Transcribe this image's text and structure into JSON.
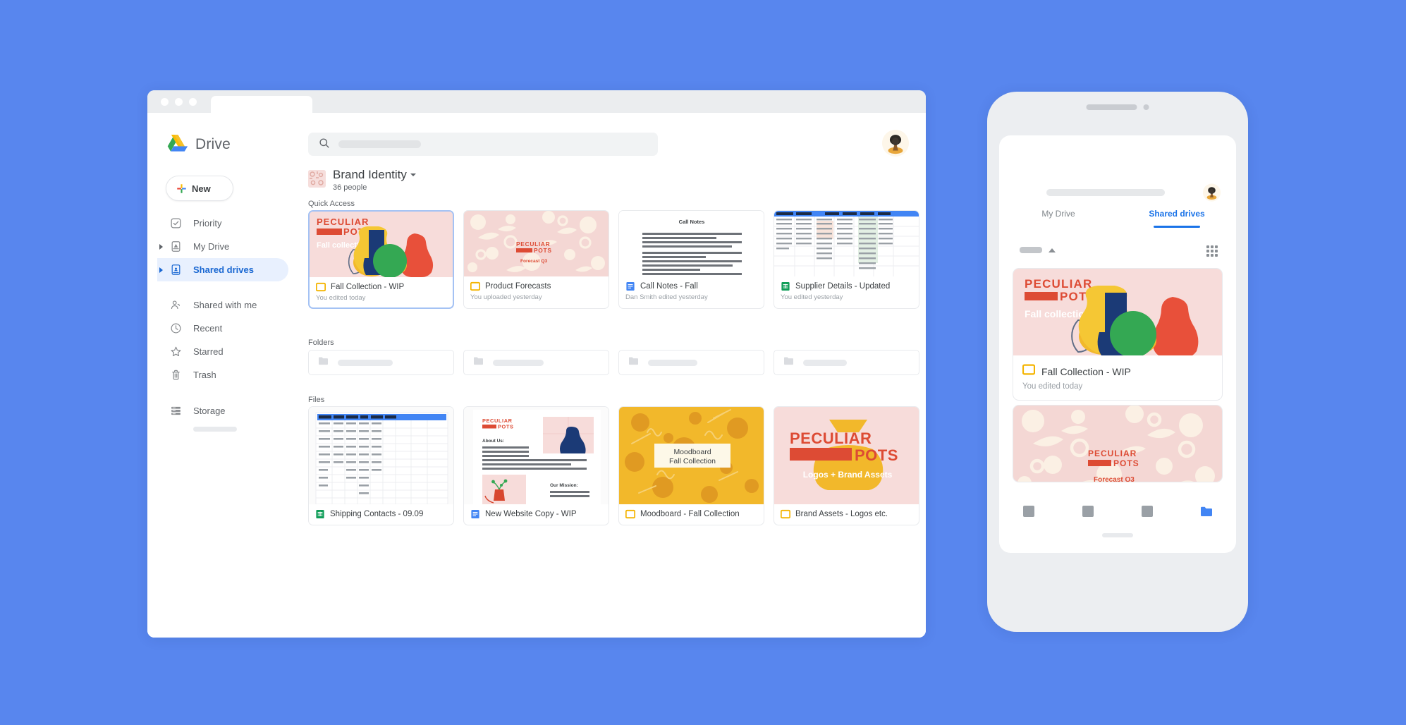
{
  "background_color": "#5886ee",
  "browser": {
    "traffic_lights": [
      "close",
      "minimize",
      "maximize"
    ],
    "tab_label": ""
  },
  "sidebar": {
    "brand": {
      "label": "Drive",
      "icon": "google-drive-logo"
    },
    "new_button": {
      "label": "New",
      "icon": "plus-icon"
    },
    "items": [
      {
        "label": "Priority",
        "icon": "check-circle-icon",
        "expandable": false,
        "active": false
      },
      {
        "label": "My Drive",
        "icon": "my-drive-icon",
        "expandable": true,
        "active": false
      },
      {
        "label": "Shared drives",
        "icon": "shared-drives-icon",
        "expandable": true,
        "active": true
      },
      {
        "label": "Shared with me",
        "icon": "people-icon",
        "expandable": false,
        "active": false
      },
      {
        "label": "Recent",
        "icon": "clock-icon",
        "expandable": false,
        "active": false
      },
      {
        "label": "Starred",
        "icon": "star-icon",
        "expandable": false,
        "active": false
      },
      {
        "label": "Trash",
        "icon": "trash-icon",
        "expandable": false,
        "active": false
      }
    ],
    "storage": {
      "label": "Storage",
      "icon": "storage-icon"
    }
  },
  "header": {
    "search": {
      "placeholder": "",
      "icon": "search-icon"
    },
    "avatar": {
      "name": "user-avatar"
    }
  },
  "breadcrumb": {
    "title": "Brand Identity",
    "subtitle": "36 people",
    "dropdown_icon": "chevron-down-icon"
  },
  "sections": {
    "quick_access_label": "Quick Access",
    "folders_label": "Folders",
    "files_label": "Files"
  },
  "quick_access": [
    {
      "title": "Fall Collection - WIP",
      "subtitle": "You edited today",
      "icon": "slides-icon",
      "selected": true,
      "thumb": "peculiar-pots-fall-collection",
      "thumb_heading": "PECULIAR POTS",
      "thumb_caption": "Fall collection."
    },
    {
      "title": "Product Forecasts",
      "subtitle": "You uploaded yesterday",
      "icon": "slides-icon",
      "selected": false,
      "thumb": "peculiar-pots-pattern",
      "thumb_heading": "PECULIAR POTS",
      "thumb_caption": "Forecast Q3"
    },
    {
      "title": "Call Notes - Fall",
      "subtitle": "Dan Smith edited yesterday",
      "icon": "docs-icon",
      "selected": false,
      "thumb": "document-preview",
      "thumb_heading": "Call Notes",
      "thumb_caption": ""
    },
    {
      "title": "Supplier Details - Updated",
      "subtitle": "You edited yesterday",
      "icon": "sheets-icon",
      "selected": false,
      "thumb": "spreadsheet-preview",
      "thumb_heading": "",
      "thumb_caption": ""
    }
  ],
  "folders": [
    {
      "icon": "folder-icon",
      "label": ""
    },
    {
      "icon": "folder-icon",
      "label": ""
    },
    {
      "icon": "folder-icon",
      "label": ""
    },
    {
      "icon": "folder-icon",
      "label": ""
    }
  ],
  "files": [
    {
      "title": "Shipping Contacts - 09.09",
      "subtitle": "",
      "icon": "sheets-icon",
      "thumb": "spreadsheet-preview"
    },
    {
      "title": "New Website Copy - WIP",
      "subtitle": "",
      "icon": "docs-icon",
      "thumb": "website-copy-doc",
      "thumb_heading": "PECULIAR POTS",
      "thumb_section_1": "About Us:",
      "thumb_section_2": "Our Mission:"
    },
    {
      "title": "Moodboard - Fall Collection",
      "subtitle": "",
      "icon": "slides-icon",
      "thumb": "moodboard-yellow",
      "thumb_caption_line1": "Moodboard",
      "thumb_caption_line2": "Fall Collection"
    },
    {
      "title": "Brand Assets - Logos etc.",
      "subtitle": "",
      "icon": "slides-icon",
      "thumb": "brand-assets-pink",
      "thumb_heading": "PECULIAR POTS",
      "thumb_caption": "Logos + Brand Assets"
    }
  ],
  "phone": {
    "search": {
      "placeholder": ""
    },
    "menu_icon": "hamburger-icon",
    "avatar": {
      "name": "user-avatar"
    },
    "tabs": [
      {
        "label": "My Drive",
        "active": false
      },
      {
        "label": "Shared drives",
        "active": true
      }
    ],
    "grid_view_icon": "grid-view-icon",
    "cards": [
      {
        "title": "Fall Collection - WIP",
        "subtitle": "You edited today",
        "icon": "slides-icon",
        "thumb_heading": "PECULIAR POTS",
        "thumb_caption": "Fall collection."
      },
      {
        "title": "",
        "subtitle": "",
        "icon": "slides-icon",
        "thumb_heading": "PECULIAR POTS",
        "thumb_caption": "Forecast Q3"
      }
    ],
    "bottom_nav": [
      {
        "icon": "nav-item-icon",
        "active": false
      },
      {
        "icon": "nav-item-icon",
        "active": false
      },
      {
        "icon": "nav-item-icon",
        "active": false
      },
      {
        "icon": "folder-icon",
        "active": true
      }
    ]
  },
  "colors": {
    "accent_blue": "#1a73e8",
    "brand_red": "#dd4b34",
    "pink": "#f7dcda",
    "yellow": "#f2b82b",
    "green": "#34a853",
    "navy": "#1b3a76"
  }
}
